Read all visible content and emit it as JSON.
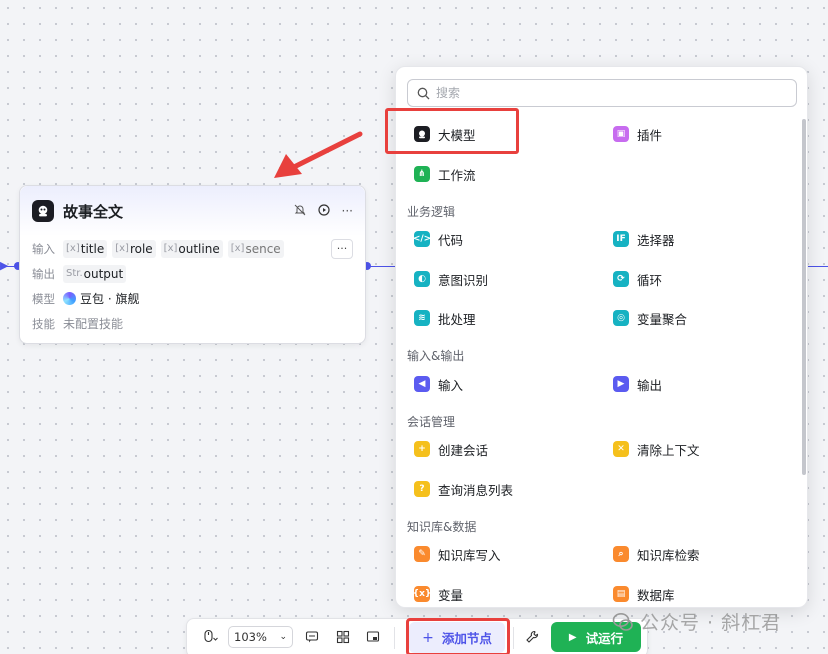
{
  "node": {
    "title": "故事全文",
    "input_label": "输入",
    "output_label": "输出",
    "model_label": "模型",
    "skill_label": "技能",
    "inputs": [
      "title",
      "role",
      "outline",
      "sence"
    ],
    "input_type": "[x]",
    "output_type": "Str.",
    "output": "output",
    "model": "豆包 · 旗舰",
    "skill": "未配置技能",
    "more": "···"
  },
  "panel": {
    "search_placeholder": "搜索",
    "items": {
      "llm": "大模型",
      "plugin": "插件",
      "workflow": "工作流",
      "code": "代码",
      "selector": "选择器",
      "intent": "意图识别",
      "loop": "循环",
      "batch": "批处理",
      "var_agg": "变量聚合",
      "input": "输入",
      "output": "输出",
      "create_conv": "创建会话",
      "clear_ctx": "清除上下文",
      "query_msgs": "查询消息列表",
      "kb_write": "知识库写入",
      "kb_search": "知识库检索",
      "variable": "变量",
      "database": "数据库"
    },
    "sections": {
      "logic": "业务逻辑",
      "io": "输入&输出",
      "session": "会话管理",
      "kb": "知识库&数据"
    }
  },
  "toolbar": {
    "zoom": "103%",
    "add_node": "添加节点",
    "run": "试运行"
  },
  "watermark": {
    "text": "公众号 · 斜杠君"
  },
  "colors": {
    "accent": "#4d53e8",
    "run_green": "#1fb255",
    "highlight_red": "#e8403d"
  }
}
